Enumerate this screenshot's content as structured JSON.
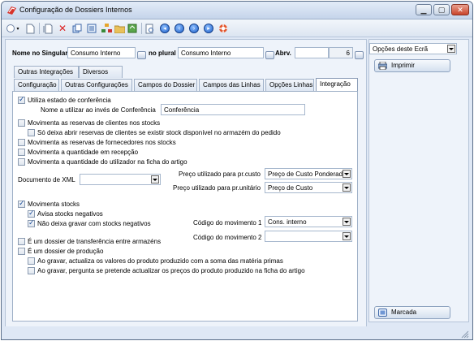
{
  "window": {
    "title": "Configuração de Dossiers Internos"
  },
  "header": {
    "singular_label": "Nome no Singular",
    "singular_value": "Consumo Interno",
    "plural_label": "no plural",
    "plural_value": "Consumo Interno",
    "abrv_label": "Abrv.",
    "abrv_value": "",
    "abrv_num": "6"
  },
  "tabs_row1": [
    "Outras Integrações",
    "Diversos"
  ],
  "tabs_row2": [
    "Configuração",
    "Outras Configurações",
    "Campos do Dossier",
    "Campos das Linhas",
    "Opções Linhas",
    "Integração"
  ],
  "panel": {
    "conf_check": "Utiliza estado de conferência",
    "conf_name_label": "Nome a utilizar ao invés de Conferência",
    "conf_name_value": "Conferência",
    "res_clientes": "Movimenta as reservas de clientes nos stocks",
    "res_clientes_sub": "Só deixa abrir reservas de clientes se existir stock disponível no armazém do pedido",
    "res_fornecedores": "Movimenta as reservas de fornecedores nos stocks",
    "qtd_recepcao": "Movimenta a quantidade em recepção",
    "qtd_utilizador": "Movimenta a quantidade do utilizador na ficha do artigo",
    "xml_label": "Documento de XML",
    "xml_value": "",
    "preco_custo_label": "Preço utilizado para pr.custo",
    "preco_custo_value": "Preço de Custo Ponderad",
    "preco_unit_label": "Preço utilizado para pr.unitário",
    "preco_unit_value": "Preço de Custo",
    "mov_stocks": "Movimenta stocks",
    "avisa_neg": "Avisa stocks negativos",
    "nao_deixa": "Não deixa gravar com stocks negativos",
    "cod_mov1_label": "Código do movimento 1",
    "cod_mov1_value": "Cons. interno",
    "cod_mov2_label": "Código do movimento 2",
    "cod_mov2_value": "",
    "transf": "É um dossier de transferência entre armazéns",
    "producao": "É um dossier de produção",
    "grav1": "Ao gravar, actualiza os valores do produto produzido com a soma das matéria primas",
    "grav2": "Ao gravar, pergunta se pretende actualizar os preços do produto produzido na ficha do artigo"
  },
  "side": {
    "options_value": "Opções deste Ecrã",
    "print_label": "Imprimir",
    "bookmark_label": "Marcada"
  },
  "colors": {
    "accent": "#1c5fc9",
    "frame": "#dfe8f5"
  }
}
